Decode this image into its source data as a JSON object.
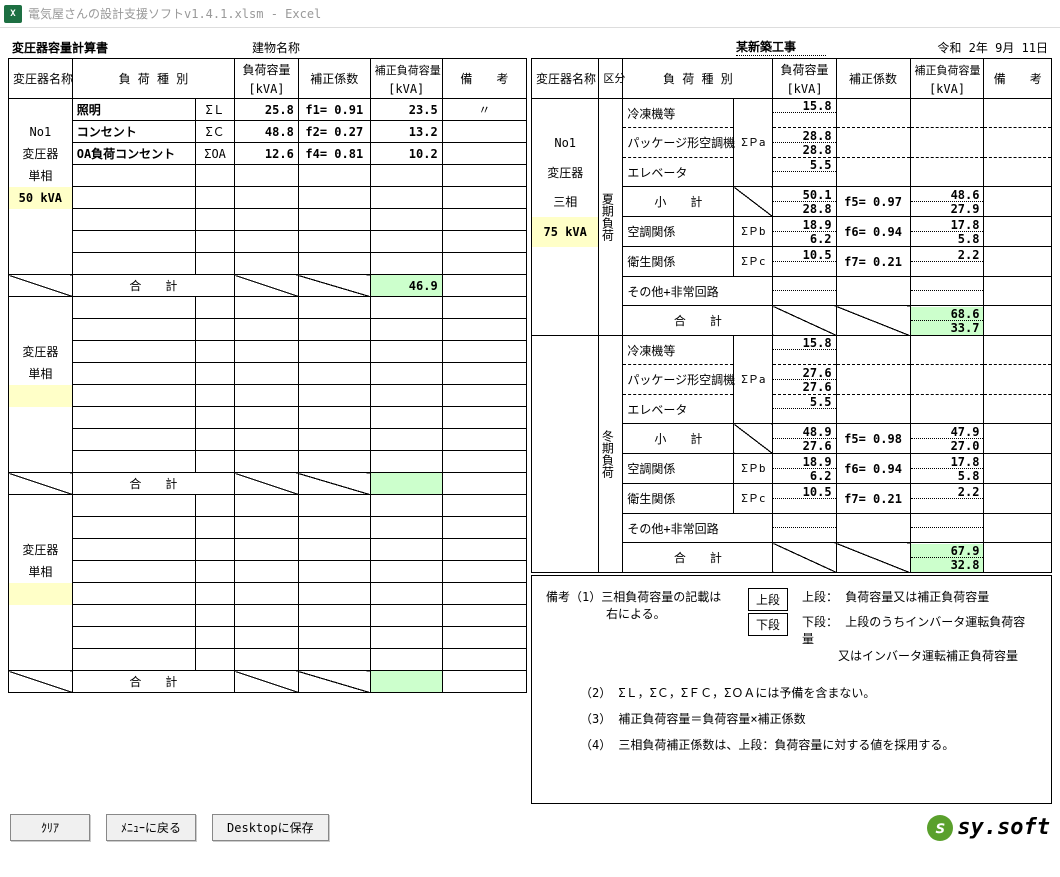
{
  "titlebar": {
    "appTitle": "電気屋さんの設計支援ソフトv1.4.1.xlsm - Excel"
  },
  "header": {
    "docTitle": "変圧器容量計算書",
    "buildingLabel": "建物名称",
    "buildingName": "某新築工事",
    "date": "令和 2年 9月 11日"
  },
  "cols": {
    "transName": "変圧器名称",
    "loadType": "負 荷 種 別",
    "loadCap": "負荷容量",
    "loadCapUnit": "[kVA]",
    "corr": "補正係数",
    "corrCap": "補正負荷容量",
    "corrCapUnit": "[kVA]",
    "note": "備　　考",
    "div": "区分"
  },
  "left": {
    "block1": {
      "no": "No1",
      "type": "変圧器",
      "phase": "単相",
      "rating": "50 kVA",
      "rows": [
        {
          "label": "照明",
          "sum": "ΣＬ",
          "cap": "25.8",
          "corr": "f1= 0.91",
          "ccap": "23.5"
        },
        {
          "label": "コンセント",
          "sum": "ΣＣ",
          "cap": "48.8",
          "corr": "f2= 0.27",
          "ccap": "13.2"
        },
        {
          "label": "OA負荷コンセント",
          "sum": "ΣOA",
          "cap": "12.6",
          "corr": "f4= 0.81",
          "ccap": "10.2"
        }
      ],
      "totalLabel": "合　　計",
      "total": "46.9"
    },
    "labels": {
      "type": "変圧器",
      "phase": "単相",
      "totalLabel": "合　　計"
    }
  },
  "right": {
    "no": "No1",
    "type": "変圧器",
    "phase": "三相",
    "rating": "75 kVA",
    "seasonSummer": "夏期負荷",
    "seasonWinter": "冬期負荷",
    "rows": {
      "reefer": "冷凍機等",
      "package": "パッケージ形空調機",
      "elevator": "エレベータ",
      "subtotal": "小　　計",
      "hvac": "空調関係",
      "sanitary": "衛生関係",
      "other": "その他+非常回路",
      "total": "合　　計"
    },
    "summer": {
      "reefer": {
        "cap1": "15.8"
      },
      "package": {
        "cap1": "28.8",
        "cap2": "28.8"
      },
      "elevator": {
        "cap1": "5.5"
      },
      "subtotal": {
        "cap1": "50.1",
        "cap2": "28.8",
        "corr": "f5= 0.97",
        "cc1": "48.6",
        "cc2": "27.9"
      },
      "hvac": {
        "cap1": "18.9",
        "cap2": "6.2",
        "corr": "f6= 0.94",
        "cc1": "17.8",
        "cc2": "5.8"
      },
      "sanitary": {
        "cap1": "10.5",
        "corr": "f7= 0.21",
        "cc1": "2.2"
      },
      "total": {
        "cc1": "68.6",
        "cc2": "33.7"
      }
    },
    "winter": {
      "reefer": {
        "cap1": "15.8"
      },
      "package": {
        "cap1": "27.6",
        "cap2": "27.6"
      },
      "elevator": {
        "cap1": "5.5"
      },
      "subtotal": {
        "cap1": "48.9",
        "cap2": "27.6",
        "corr": "f5= 0.98",
        "cc1": "47.9",
        "cc2": "27.0"
      },
      "hvac": {
        "cap1": "18.9",
        "cap2": "6.2",
        "corr": "f6= 0.94",
        "cc1": "17.8",
        "cc2": "5.8"
      },
      "sanitary": {
        "cap1": "10.5",
        "corr": "f7= 0.21",
        "cc1": "2.2"
      },
      "total": {
        "cc1": "67.9",
        "cc2": "32.8"
      }
    },
    "sum": {
      "spa": "ΣＰa",
      "spb": "ΣＰb",
      "spc": "ΣＰc"
    }
  },
  "notes": {
    "n1a": "備考（1）三相負荷容量の記載は",
    "n1b": "右による。",
    "upper": "上段",
    "lower": "下段",
    "upperTxt": "上段： 負荷容量又は補正負荷容量",
    "lowerTxt": "下段： 上段のうちインバータ運転負荷容量",
    "lowerTxt2": "又はインバータ運転補正負荷容量",
    "n2": "（2） ΣＬ，ΣＣ，ΣＦＣ，ΣＯＡには予備を含まない。",
    "n3": "（3） 補正負荷容量＝負荷容量×補正係数",
    "n4": "（4） 三相負荷補正係数は、上段：負荷容量に対する値を採用する。"
  },
  "buttons": {
    "clear": "ｸﾘｱ",
    "menu": "ﾒﾆｭｰに戻る",
    "save": "Desktopに保存"
  },
  "logo": {
    "text": "sy.soft"
  }
}
